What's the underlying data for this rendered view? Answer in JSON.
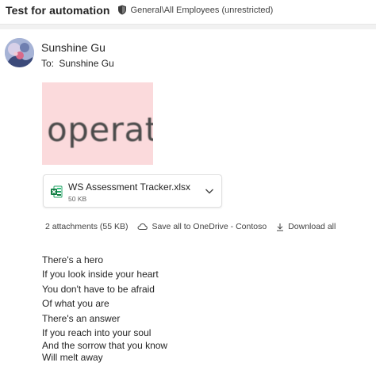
{
  "header": {
    "subject": "Test for automation",
    "sensitivity_label": "General\\All Employees (unrestricted)"
  },
  "message": {
    "sender_name": "Sunshine Gu",
    "to_label": "To:",
    "to_recipient": "Sunshine Gu"
  },
  "inline_image": {
    "text": "operati"
  },
  "attachment": {
    "file_name": "WS Assessment Tracker.xlsx",
    "file_size": "50 KB",
    "file_icon": "excel-icon"
  },
  "attachments_bar": {
    "count_label": "2 attachments (55 KB)",
    "save_all_label": "Save all to OneDrive - Contoso",
    "download_all_label": "Download all"
  },
  "body": {
    "lines": [
      "There's a hero",
      "If you look inside your heart",
      "You don't have to be afraid",
      "Of what you are",
      "There's an answer",
      "If you reach into your soul",
      "And the sorrow that you know",
      "Will melt away"
    ]
  }
}
